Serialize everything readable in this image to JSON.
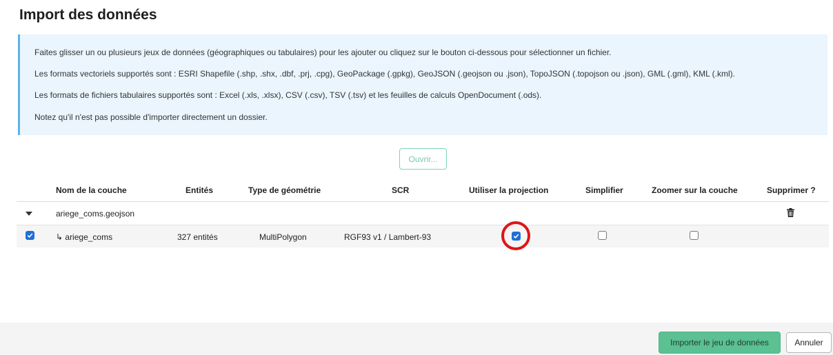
{
  "title": "Import des données",
  "info": {
    "lines": [
      "Faites glisser un ou plusieurs jeux de données (géographiques ou tabulaires) pour les ajouter ou cliquez sur le bouton ci-dessous pour sélectionner un fichier.",
      "Les formats vectoriels supportés sont : ESRI Shapefile (.shp, .shx, .dbf, .prj, .cpg), GeoPackage (.gpkg), GeoJSON (.geojson ou .json), TopoJSON (.topojson ou .json), GML (.gml), KML (.kml).",
      "Les formats de fichiers tabulaires supportés sont : Excel (.xls, .xlsx), CSV (.csv), TSV (.tsv) et les feuilles de calculs OpenDocument (.ods).",
      "Notez qu'il n'est pas possible d'importer directement un dossier."
    ]
  },
  "open_button": "Ouvrir...",
  "table": {
    "headers": {
      "layer_name": "Nom de la couche",
      "entities": "Entités",
      "geometry_type": "Type de géométrie",
      "crs": "SCR",
      "use_projection": "Utiliser la projection",
      "simplify": "Simplifier",
      "zoom": "Zoomer sur la couche",
      "delete": "Supprimer ?"
    },
    "file_row": {
      "name": "ariege_coms.geojson",
      "expanded": true
    },
    "layer_row": {
      "selected": true,
      "name": "↳ ariege_coms",
      "entities": "327 entités",
      "geometry_type": "MultiPolygon",
      "crs": "RGF93 v1 / Lambert-93",
      "use_projection": true,
      "simplify": false,
      "zoom": false
    }
  },
  "footer": {
    "import_button": "Importer le jeu de données",
    "cancel_button": "Annuler"
  },
  "colors": {
    "accent_green": "#5bc092",
    "info_border": "#5bb3ea",
    "highlight": "#e01414",
    "checkbox": "#1f6fd8"
  }
}
